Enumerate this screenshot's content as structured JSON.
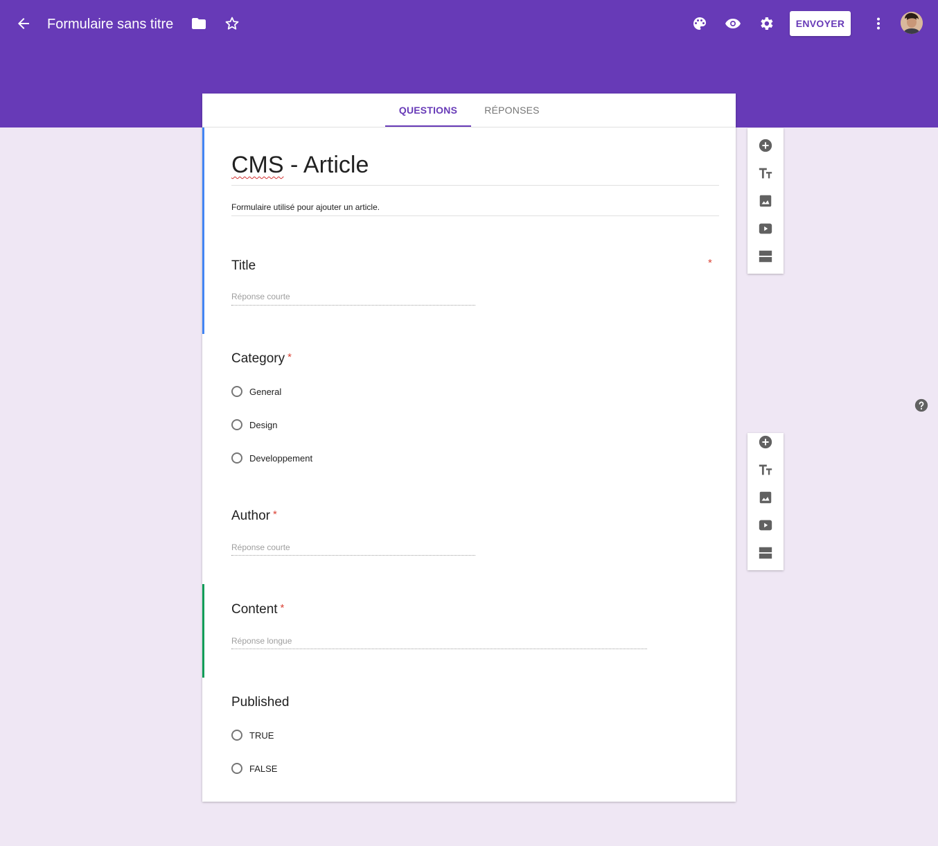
{
  "topbar": {
    "title": "Formulaire sans titre",
    "send_label": "ENVOYER",
    "icons": [
      "arrow-back-icon",
      "folder-icon",
      "star-icon",
      "palette-icon",
      "eye-icon",
      "gear-icon",
      "more-vert-icon"
    ],
    "color": "#673ab7"
  },
  "tabs": [
    {
      "label": "QUESTIONS",
      "active": true
    },
    {
      "label": "RÉPONSES",
      "active": false
    }
  ],
  "form": {
    "title_misspelled": "CMS",
    "title_rest": " - Article",
    "description": "Formulaire utilisé pour ajouter un article."
  },
  "questions": [
    {
      "title": "Title",
      "required_mark": "*",
      "type": "short",
      "placeholder": "Réponse courte"
    },
    {
      "title": "Category",
      "required_mark": "*",
      "type": "radio",
      "options": [
        "General",
        "Design",
        "Developpement"
      ]
    },
    {
      "title": "Author",
      "required_mark": "*",
      "type": "short",
      "placeholder": "Réponse courte"
    },
    {
      "title": "Content",
      "required_mark": "*",
      "type": "long",
      "placeholder": "Réponse longue"
    },
    {
      "title": "Published",
      "type": "radio",
      "options": [
        "TRUE",
        "FALSE"
      ]
    }
  ],
  "toolbar_icons": [
    "add-question-icon",
    "title-text-icon",
    "image-icon",
    "video-icon",
    "section-icon"
  ],
  "accent_colors": {
    "section_bar": "#4285f4",
    "active_bar": "#0f9d58",
    "required": "#db4437"
  }
}
